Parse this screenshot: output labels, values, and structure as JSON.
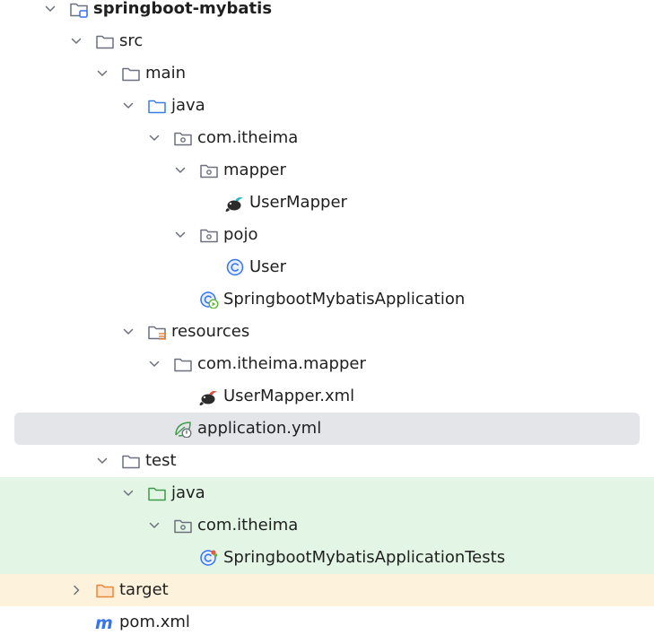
{
  "project_tree": {
    "nodes": [
      {
        "label": "springboot-mybatis",
        "icon": "module-folder-icon",
        "level": 0,
        "expanded": true,
        "bold": true
      },
      {
        "label": "src",
        "icon": "folder-icon",
        "level": 1,
        "expanded": true
      },
      {
        "label": "main",
        "icon": "folder-icon",
        "level": 2,
        "expanded": true
      },
      {
        "label": "java",
        "icon": "source-folder-icon",
        "level": 3,
        "expanded": true
      },
      {
        "label": "com.itheima",
        "icon": "package-icon",
        "level": 4,
        "expanded": true
      },
      {
        "label": "mapper",
        "icon": "package-icon",
        "level": 5,
        "expanded": true
      },
      {
        "label": "UserMapper",
        "icon": "mybatis-mapper-icon",
        "level": 6
      },
      {
        "label": "pojo",
        "icon": "package-icon",
        "level": 5,
        "expanded": true
      },
      {
        "label": "User",
        "icon": "java-class-icon",
        "level": 6
      },
      {
        "label": "SpringbootMybatisApplication",
        "icon": "spring-boot-application-icon",
        "level": 5
      },
      {
        "label": "resources",
        "icon": "resources-folder-icon",
        "level": 3,
        "expanded": true
      },
      {
        "label": "com.itheima.mapper",
        "icon": "folder-icon",
        "level": 4,
        "expanded": true
      },
      {
        "label": "UserMapper.xml",
        "icon": "mybatis-xml-icon",
        "level": 5
      },
      {
        "label": "application.yml",
        "icon": "spring-config-icon",
        "level": 4,
        "selected": true
      },
      {
        "label": "test",
        "icon": "folder-icon",
        "level": 2,
        "expanded": true
      },
      {
        "label": "java",
        "icon": "test-folder-icon",
        "level": 3,
        "expanded": true,
        "band": "green"
      },
      {
        "label": "com.itheima",
        "icon": "package-icon",
        "level": 4,
        "expanded": true,
        "band": "green"
      },
      {
        "label": "SpringbootMybatisApplicationTests",
        "icon": "spring-test-class-icon",
        "level": 5,
        "band": "green"
      },
      {
        "label": "target",
        "icon": "excluded-folder-icon",
        "level": 1,
        "expanded": false,
        "band": "yellow"
      },
      {
        "label": "pom.xml",
        "icon": "maven-pom-icon",
        "level": 1
      }
    ]
  },
  "colors": {
    "selection": "#e4e5e9",
    "test_band": "#e3f6e5",
    "excluded_band": "#fdf3dc",
    "source_folder": "#3b7ddd",
    "test_folder": "#3f9a4a",
    "excluded_folder": "#e8893a",
    "maven": "#3574f0"
  }
}
